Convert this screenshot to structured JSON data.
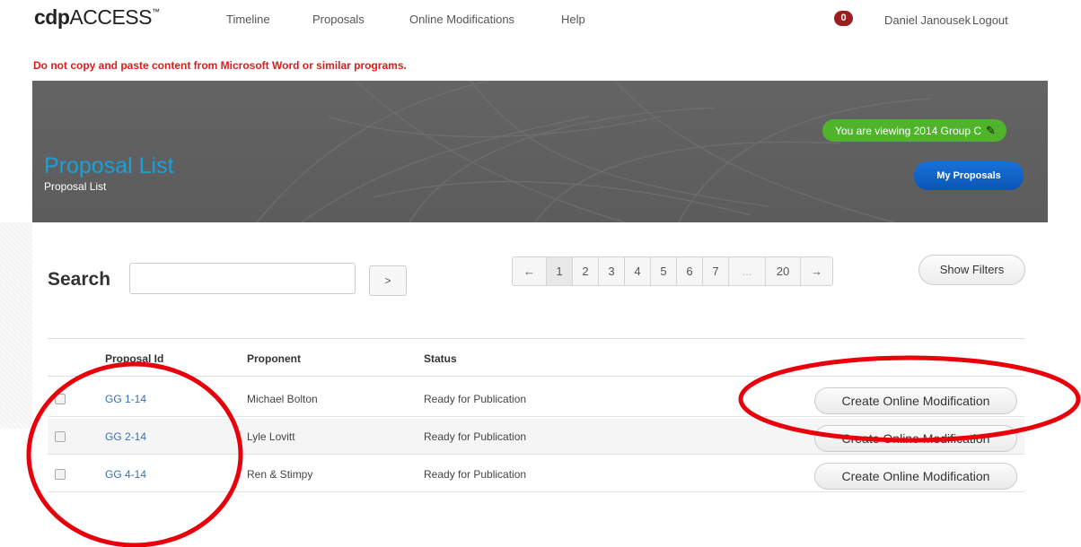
{
  "app": {
    "logo_prefix": "cdp",
    "logo_suffix": "ACCESS",
    "logo_mark": "™"
  },
  "nav": {
    "timeline": "Timeline",
    "proposals": "Proposals",
    "online_modifications": "Online Modifications",
    "help": "Help",
    "notification_count": "0",
    "user_name": "Daniel Janousek",
    "logout": "Logout"
  },
  "warning": "Do not copy and paste content from Microsoft Word or similar programs.",
  "banner": {
    "viewing_label": "You are viewing 2014 Group C",
    "title": "Proposal List",
    "breadcrumb": "Proposal List",
    "my_proposals": "My Proposals"
  },
  "search": {
    "label": "Search",
    "placeholder": "",
    "go": ">"
  },
  "pagination": {
    "prev": "←",
    "pages": [
      "1",
      "2",
      "3",
      "4",
      "5",
      "6",
      "7"
    ],
    "ellipsis": "...",
    "last": "20",
    "next": "→",
    "current": "1"
  },
  "show_filters": "Show Filters",
  "table": {
    "headers": {
      "id": "Proposal Id",
      "proponent": "Proponent",
      "status": "Status"
    },
    "rows": [
      {
        "id": "GG 1-14",
        "proponent": "Michael Bolton",
        "status": "Ready for Publication",
        "action": "Create Online Modification"
      },
      {
        "id": "GG 2-14",
        "proponent": "Lyle Lovitt",
        "status": "Ready for Publication",
        "action": "Create Online Modification"
      },
      {
        "id": "GG 4-14",
        "proponent": "Ren & Stimpy",
        "status": "Ready for Publication",
        "action": "Create Online Modification"
      }
    ]
  },
  "colors": {
    "accent_blue": "#1aa0d8",
    "warning_red": "#e01b1b",
    "viewing_green": "#4fb32b",
    "button_blue": "#1872d9",
    "annotation_red": "#e8000b"
  }
}
